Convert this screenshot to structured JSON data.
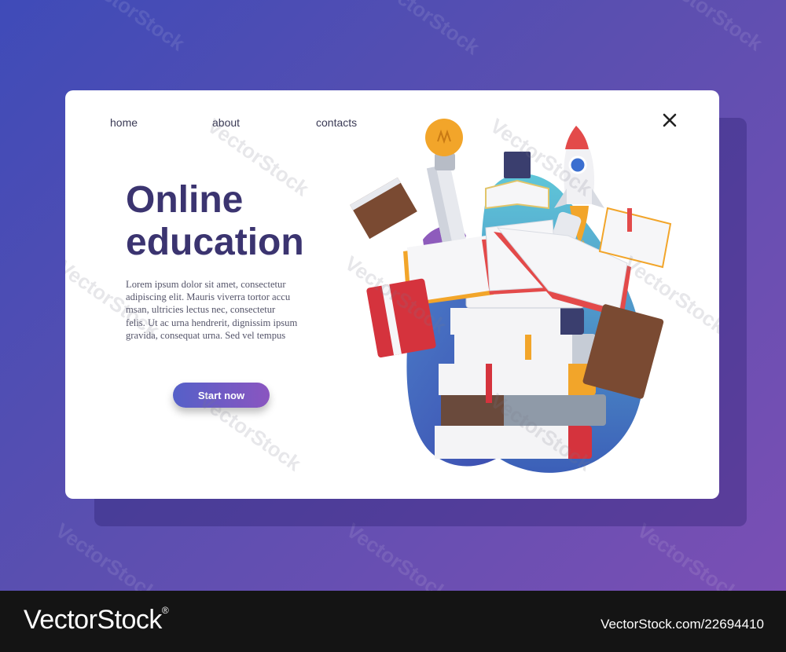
{
  "nav": {
    "items": [
      {
        "label": "home"
      },
      {
        "label": "about"
      },
      {
        "label": "contacts"
      }
    ]
  },
  "hero": {
    "title_line1": "Online",
    "title_line2": "education",
    "body_lines": [
      "Lorem ipsum dolor sit amet, consectetur",
      "adipiscing elit. Mauris viverra tortor accu",
      "msan, ultricies lectus nec, consectetur",
      "felis. Ut ac urna hendrerit, dignissim ipsum",
      "gravida, consequat urna. Sed vel tempus"
    ],
    "cta_label": "Start now"
  },
  "icons": {
    "close": "close-icon",
    "illustration": [
      "book-stack-icon",
      "light-bulb-icon",
      "rocket-icon",
      "open-book-icon"
    ]
  },
  "watermark": {
    "text": "VectorStock",
    "registered": "®"
  },
  "footer": {
    "logo": "VectorStock",
    "registered": "®",
    "url": "VectorStock.com/22694410"
  },
  "colors": {
    "accent": "#3b3470",
    "button_start": "#5560c8",
    "button_end": "#8a55c0",
    "background": "#4a4db8"
  }
}
